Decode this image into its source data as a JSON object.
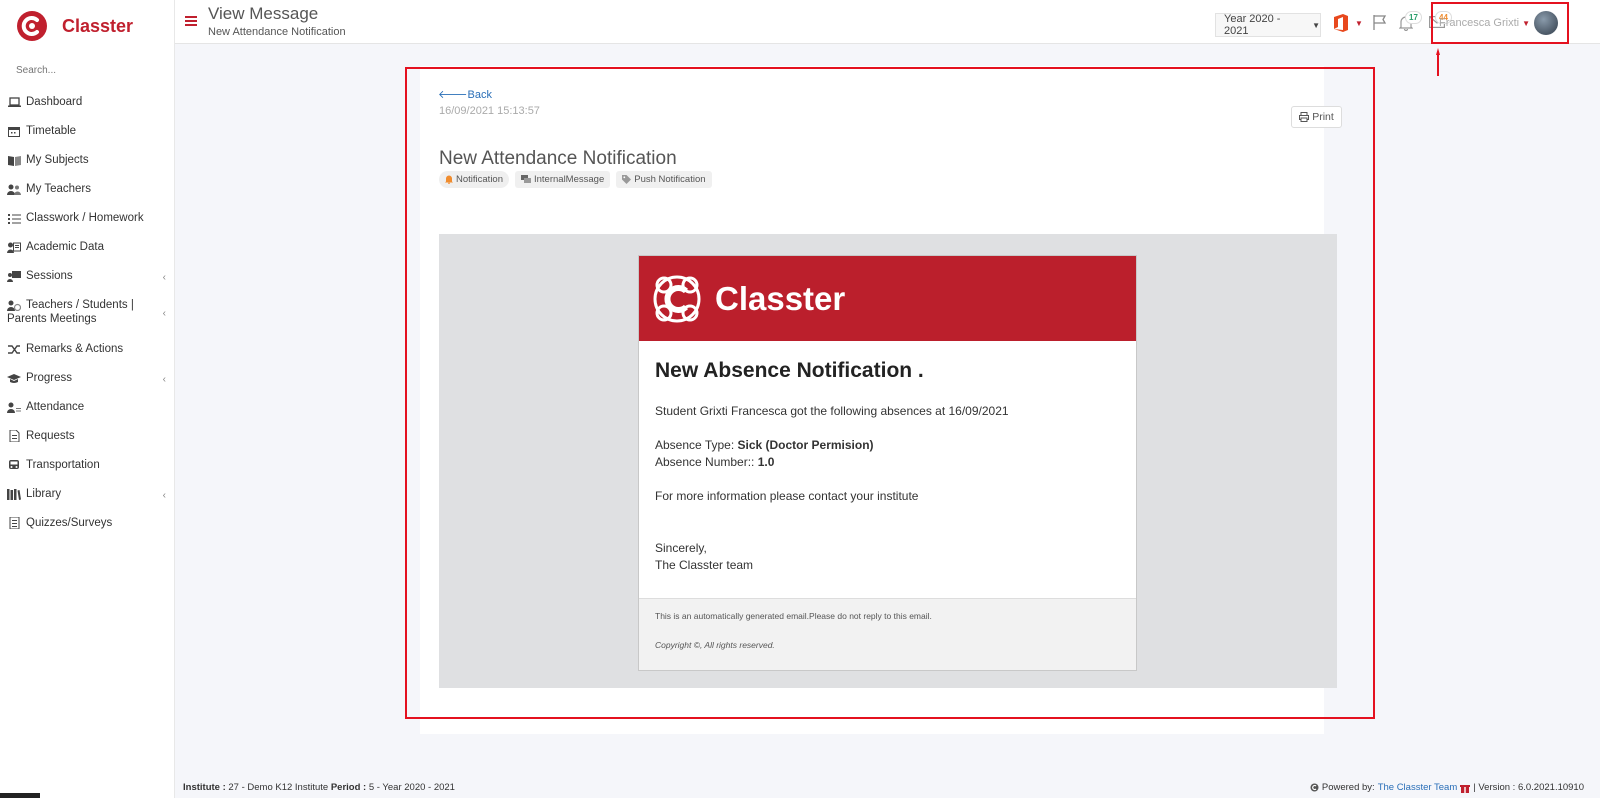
{
  "app": {
    "name": "Classter"
  },
  "sidebar": {
    "search_placeholder": "Search...",
    "items": [
      {
        "label": "Dashboard",
        "icon": "laptop-icon"
      },
      {
        "label": "Timetable",
        "icon": "calendar-icon"
      },
      {
        "label": "My Subjects",
        "icon": "book-icon"
      },
      {
        "label": "My Teachers",
        "icon": "users-icon"
      },
      {
        "label": "Classwork / Homework",
        "icon": "list-icon"
      },
      {
        "label": "Academic Data",
        "icon": "id-card-icon"
      },
      {
        "label": "Sessions",
        "icon": "presentation-icon"
      },
      {
        "label": "Teachers / Students | Parents Meetings",
        "icon": "meeting-icon"
      },
      {
        "label": "Remarks & Actions",
        "icon": "shuffle-icon"
      },
      {
        "label": "Progress",
        "icon": "graduation-cap-icon"
      },
      {
        "label": "Attendance",
        "icon": "user-check-icon"
      },
      {
        "label": "Requests",
        "icon": "document-icon"
      },
      {
        "label": "Transportation",
        "icon": "bus-icon"
      },
      {
        "label": "Library",
        "icon": "books-icon"
      },
      {
        "label": "Quizzes/Surveys",
        "icon": "quiz-icon"
      }
    ]
  },
  "header": {
    "title": "View Message",
    "subtitle": "New Attendance Notification",
    "year": "Year 2020 - 2021",
    "notifications_count": "17",
    "messages_count": "44",
    "user_name": "Francesca Grixti"
  },
  "message": {
    "back_label": "Back",
    "date": "16/09/2021 15:13:57",
    "print_label": "Print",
    "title": "New Attendance Notification",
    "tags": [
      "Notification",
      "InternalMessage",
      "Push Notification"
    ]
  },
  "email": {
    "brand": "Classter",
    "heading": "New Absence Notification .",
    "intro": "Student Grixti Francesca got the following absences at 16/09/2021",
    "type_label": "Absence Type: ",
    "type_value": "Sick (Doctor Permision)",
    "number_label": "Absence Number:: ",
    "number_value": "1.0",
    "contact": "For more information please contact your institute",
    "sign_1": "Sincerely,",
    "sign_2": "The Classter team",
    "footer_note": "This is an automatically generated email.Please do not reply to this email.",
    "copyright": "Copyright ©, All rights reserved."
  },
  "footer": {
    "institute_label": "Institute :",
    "institute_value": " 27 - Demo K12 Institute ",
    "period_label": "Period :",
    "period_value": " 5 - Year 2020 - 2021",
    "powered_by": "Powered by:",
    "team_link": "The Classter Team",
    "version": "| Version : 6.0.2021.10910"
  },
  "colors": {
    "brand": "#c0202e",
    "highlight": "#e4111f",
    "link": "#2a6fb8"
  }
}
